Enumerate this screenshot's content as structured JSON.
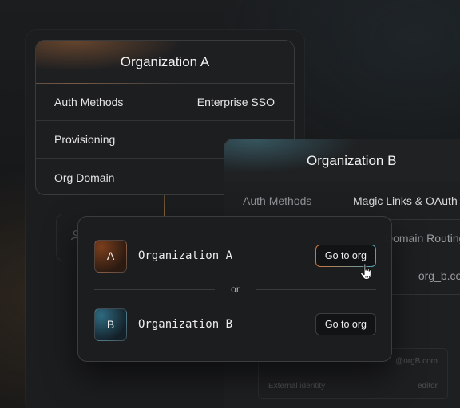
{
  "org_a_card": {
    "title": "Organization A",
    "rows": [
      {
        "label": "Auth Methods",
        "value": "Enterprise SSO"
      },
      {
        "label": "Provisioning",
        "value": ""
      },
      {
        "label": "Org Domain",
        "value": ""
      }
    ]
  },
  "org_b_card": {
    "title": "Organization B",
    "rows": [
      {
        "label": "Auth Methods",
        "value": "Magic Links & OAuth"
      },
      {
        "label": "",
        "value": "Domain Routing"
      },
      {
        "label": "",
        "value": "org_b.com"
      }
    ],
    "members": [
      {
        "email": "@orgB.com",
        "role": ""
      },
      {
        "identity": "External identity",
        "role": "editor"
      }
    ]
  },
  "switcher": {
    "divider_text": "or",
    "orgs": [
      {
        "initial": "A",
        "name": "Organization A",
        "button": "Go to org"
      },
      {
        "initial": "B",
        "name": "Organization B",
        "button": "Go to org"
      }
    ]
  },
  "colors": {
    "accent_orange": "#d0743a",
    "accent_teal": "#4fa3b8",
    "background": "#161718"
  },
  "icons": [
    "user-icon",
    "pointer-hand-icon"
  ]
}
